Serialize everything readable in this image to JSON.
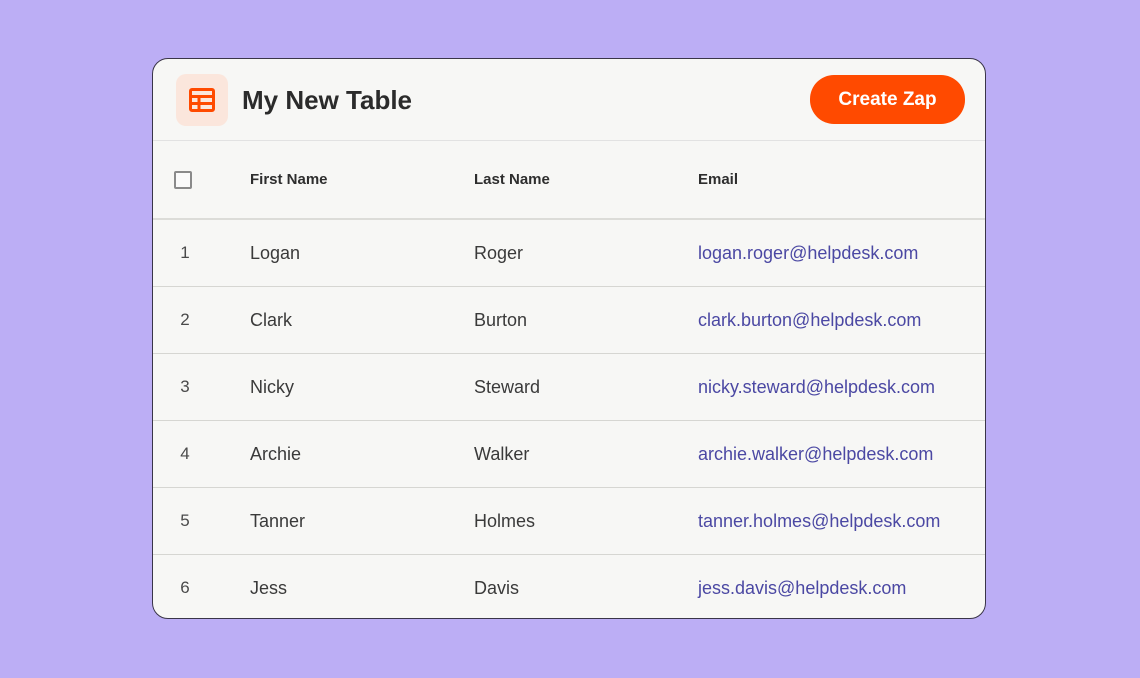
{
  "header": {
    "title": "My New Table",
    "icon": "table-icon",
    "create_label": "Create Zap",
    "accent_color": "#ff4a00"
  },
  "table": {
    "columns": [
      "First Name",
      "Last Name",
      "Email"
    ],
    "rows": [
      {
        "num": "1",
        "first": "Logan",
        "last": "Roger",
        "email": "logan.roger@helpdesk.com"
      },
      {
        "num": "2",
        "first": "Clark",
        "last": "Burton",
        "email": "clark.burton@helpdesk.com"
      },
      {
        "num": "3",
        "first": "Nicky",
        "last": "Steward",
        "email": "nicky.steward@helpdesk.com"
      },
      {
        "num": "4",
        "first": "Archie",
        "last": "Walker",
        "email": "archie.walker@helpdesk.com"
      },
      {
        "num": "5",
        "first": "Tanner",
        "last": "Holmes",
        "email": "tanner.holmes@helpdesk.com"
      },
      {
        "num": "6",
        "first": "Jess",
        "last": "Davis",
        "email": "jess.davis@helpdesk.com"
      }
    ]
  }
}
